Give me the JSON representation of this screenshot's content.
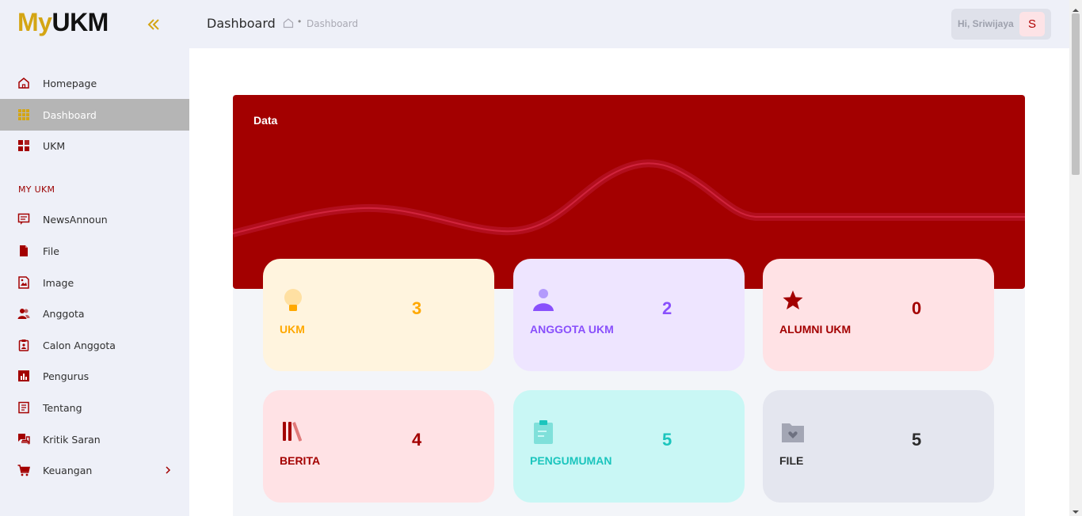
{
  "logo": {
    "part1": "My",
    "part2": "UKM"
  },
  "sidebar": {
    "items": [
      {
        "label": "Homepage",
        "icon": "home-icon"
      },
      {
        "label": "Dashboard",
        "icon": "grid-icon",
        "active": true
      },
      {
        "label": "UKM",
        "icon": "apps-icon"
      }
    ],
    "section_label": "MY UKM",
    "my_items": [
      {
        "label": "NewsAnnoun",
        "icon": "message-icon"
      },
      {
        "label": "File",
        "icon": "file-icon"
      },
      {
        "label": "Image",
        "icon": "image-icon"
      },
      {
        "label": "Anggota",
        "icon": "users-icon"
      },
      {
        "label": "Calon Anggota",
        "icon": "clipboard-user-icon"
      },
      {
        "label": "Pengurus",
        "icon": "bar-chart-icon"
      },
      {
        "label": "Tentang",
        "icon": "document-icon"
      },
      {
        "label": "Kritik Saran",
        "icon": "chat-icon"
      },
      {
        "label": "Keuangan",
        "icon": "cart-icon"
      }
    ]
  },
  "header": {
    "title": "Dashboard",
    "breadcrumb_separator": "•",
    "breadcrumb_current": "Dashboard",
    "greeting": "Hi, Sriwijaya",
    "avatar_initial": "S"
  },
  "banner": {
    "title": "Data"
  },
  "cards": [
    {
      "label": "UKM",
      "value": "3",
      "icon": "lightbulb-icon",
      "bg": "#fff4de",
      "color": "#ffa800"
    },
    {
      "label": "ANGGOTA UKM",
      "value": "2",
      "icon": "user-icon",
      "bg": "#eee5ff",
      "color": "#8950fc"
    },
    {
      "label": "ALUMNI UKM",
      "value": "0",
      "icon": "star-icon",
      "bg": "#ffe2e5",
      "color": "#a30000"
    },
    {
      "label": "BERITA",
      "value": "4",
      "icon": "library-icon",
      "bg": "#ffe2e5",
      "color": "#a30000"
    },
    {
      "label": "PENGUMUMAN",
      "value": "5",
      "icon": "clipboard-icon",
      "bg": "#c9f7f5",
      "color": "#1bc5bd"
    },
    {
      "label": "FILE",
      "value": "5",
      "icon": "folder-heart-icon",
      "bg": "#e4e6ef",
      "color": "#2b2b2b"
    }
  ],
  "colors": {
    "accent": "#a30000",
    "logo_gold": "#d4a514",
    "sidebar_bg": "#eef0f8"
  }
}
